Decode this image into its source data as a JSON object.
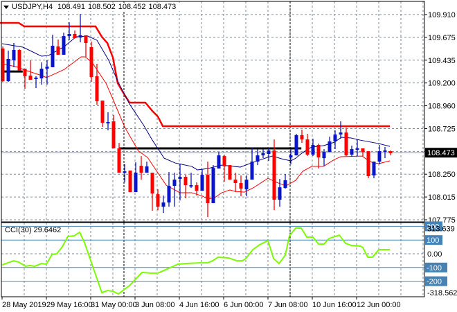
{
  "header": {
    "symbol": "USDJPY,H4",
    "open": "108.491",
    "high": "108.502",
    "low": "108.452",
    "close": "108.473"
  },
  "cci": {
    "title": "CCI(30)",
    "value": "29.6462",
    "max_label": "313.639",
    "min_label": "-318.5623",
    "zero_label": "0.00",
    "levels": [
      {
        "value": 200,
        "label": "200"
      },
      {
        "value": 100,
        "label": "100"
      },
      {
        "value": -100,
        "label": "-100"
      },
      {
        "value": -200,
        "label": "-200"
      }
    ]
  },
  "price_axis": [
    "109.910",
    "109.675",
    "109.435",
    "109.200",
    "108.960",
    "108.725",
    "108.490",
    "108.250",
    "108.015",
    "107.775"
  ],
  "current_price_label": "108.473",
  "time_axis": [
    "28 May 2019",
    "29 May 16:00",
    "31 May 00:00",
    "3 Jun 08:00",
    "4 Jun 16:00",
    "6 Jun 00:00",
    "7 Jun 08:00",
    "10 Jun 16:00",
    "12 Jun 00:00"
  ],
  "colors": {
    "bull": "#0a14c8",
    "bear": "#ff0000",
    "ma": "#000080",
    "envelope": "#ff0000",
    "channel": "#ff0000",
    "level": "#000000",
    "cci": "#7cfc00",
    "cci_levels": "#4682b4",
    "grid": "#7f8a99"
  },
  "chart_data": {
    "type": "candlestick",
    "title": "USDJPY,H4",
    "ylim": [
      107.775,
      109.91
    ],
    "current_price": 108.473,
    "candles_ohlc": [
      [
        109.556,
        109.578,
        109.21,
        109.217
      ],
      [
        109.217,
        109.535,
        109.21,
        109.448
      ],
      [
        109.434,
        109.614,
        109.362,
        109.542
      ],
      [
        109.542,
        109.55,
        109.326,
        109.326
      ],
      [
        109.347,
        109.347,
        109.138,
        109.268
      ],
      [
        109.275,
        109.434,
        109.232,
        109.232
      ],
      [
        109.239,
        109.268,
        109.145,
        109.254
      ],
      [
        109.246,
        109.412,
        109.181,
        109.347
      ],
      [
        109.347,
        109.434,
        109.181,
        109.369
      ],
      [
        109.362,
        109.701,
        109.362,
        109.585
      ],
      [
        109.578,
        109.65,
        109.492,
        109.492
      ],
      [
        109.492,
        109.722,
        109.492,
        109.686
      ],
      [
        109.686,
        109.83,
        109.643,
        109.708
      ],
      [
        109.708,
        109.744,
        109.665,
        109.665
      ],
      [
        109.672,
        109.917,
        109.621,
        109.694
      ],
      [
        109.694,
        109.694,
        109.47,
        109.614
      ],
      [
        109.571,
        109.629,
        109.21,
        109.261
      ],
      [
        109.268,
        109.398,
        108.972,
        109.008
      ],
      [
        109.015,
        109.015,
        108.741,
        108.784
      ],
      [
        108.784,
        108.893,
        108.705,
        108.792
      ],
      [
        108.799,
        108.864,
        108.518,
        108.518
      ],
      [
        108.518,
        108.575,
        108.265,
        108.265
      ],
      [
        108.265,
        108.352,
        108.164,
        108.279
      ],
      [
        108.287,
        108.287,
        108.063,
        108.063
      ],
      [
        108.063,
        108.373,
        108.063,
        108.265
      ],
      [
        108.337,
        108.438,
        108.193,
        108.265
      ],
      [
        108.265,
        108.38,
        108.265,
        108.33
      ],
      [
        108.265,
        108.265,
        107.868,
        108.049
      ],
      [
        108.041,
        108.092,
        107.875,
        107.911
      ],
      [
        107.911,
        108.027,
        107.846,
        107.955
      ],
      [
        107.955,
        108.272,
        107.911,
        108.128
      ],
      [
        108.128,
        108.265,
        107.911,
        108.193
      ],
      [
        108.2,
        108.352,
        107.976,
        108.222
      ],
      [
        108.222,
        108.243,
        107.998,
        108.135
      ],
      [
        108.128,
        108.265,
        108.106,
        108.135
      ],
      [
        108.135,
        108.164,
        108.027,
        108.077
      ],
      [
        108.077,
        108.301,
        108.077,
        108.243
      ],
      [
        108.243,
        108.38,
        107.803,
        107.948
      ],
      [
        107.948,
        108.344,
        107.948,
        108.315
      ],
      [
        108.308,
        108.481,
        108.308,
        108.445
      ],
      [
        108.438,
        108.453,
        108.171,
        108.33
      ],
      [
        108.344,
        108.344,
        108.193,
        108.193
      ],
      [
        108.193,
        108.265,
        108.063,
        108.157
      ],
      [
        108.157,
        108.236,
        108.02,
        108.099
      ],
      [
        108.092,
        108.236,
        108.02,
        108.193
      ],
      [
        108.193,
        108.525,
        108.193,
        108.38
      ],
      [
        108.38,
        108.51,
        108.344,
        108.445
      ],
      [
        108.445,
        108.51,
        108.416,
        108.467
      ],
      [
        108.46,
        108.525,
        108.388,
        108.496
      ],
      [
        108.496,
        108.611,
        107.875,
        107.984
      ],
      [
        107.984,
        108.2,
        107.911,
        108.113
      ],
      [
        108.106,
        108.251,
        108.099,
        108.186
      ],
      [
        108.424,
        108.51,
        108.352,
        108.445
      ],
      [
        108.445,
        108.669,
        108.445,
        108.655
      ],
      [
        108.655,
        108.712,
        108.575,
        108.611
      ],
      [
        108.611,
        108.669,
        108.438,
        108.453
      ],
      [
        108.453,
        108.619,
        108.438,
        108.554
      ],
      [
        108.554,
        108.568,
        108.308,
        108.424
      ],
      [
        108.416,
        108.51,
        108.337,
        108.481
      ],
      [
        108.481,
        108.64,
        108.481,
        108.59
      ],
      [
        108.59,
        108.705,
        108.51,
        108.662
      ],
      [
        108.662,
        108.799,
        108.619,
        108.683
      ],
      [
        108.683,
        108.734,
        108.438,
        108.445
      ],
      [
        108.453,
        108.546,
        108.431,
        108.51
      ],
      [
        108.503,
        108.611,
        108.438,
        108.518
      ],
      [
        108.518,
        108.518,
        108.438,
        108.481
      ],
      [
        108.489,
        108.489,
        108.207,
        108.229
      ],
      [
        108.236,
        108.38,
        108.207,
        108.38
      ],
      [
        108.38,
        108.554,
        108.352,
        108.489
      ],
      [
        108.489,
        108.532,
        108.416,
        108.496
      ],
      [
        108.489,
        108.496,
        108.445,
        108.467
      ]
    ],
    "lines": {
      "ma": [
        [
          -0.13,
          109.607
        ],
        [
          3.63,
          109.571
        ],
        [
          7,
          109.477
        ],
        [
          8.25,
          109.484
        ],
        [
          11.13,
          109.578
        ],
        [
          13.25,
          109.679
        ],
        [
          15.38,
          109.686
        ],
        [
          17,
          109.643
        ],
        [
          19.13,
          109.434
        ],
        [
          20.75,
          109.217
        ],
        [
          22.88,
          108.979
        ],
        [
          25.38,
          108.763
        ],
        [
          27,
          108.604
        ],
        [
          29.13,
          108.416
        ],
        [
          31.13,
          108.366
        ],
        [
          34.13,
          108.33
        ],
        [
          35.13,
          108.294
        ],
        [
          37,
          108.308
        ],
        [
          39.5,
          108.344
        ],
        [
          42.88,
          108.323
        ],
        [
          44.88,
          108.366
        ],
        [
          47.38,
          108.416
        ],
        [
          48.63,
          108.438
        ],
        [
          50.38,
          108.409
        ],
        [
          52,
          108.388
        ],
        [
          52.88,
          108.416
        ],
        [
          54.13,
          108.474
        ],
        [
          55.75,
          108.532
        ],
        [
          57.88,
          108.546
        ],
        [
          59.88,
          108.582
        ],
        [
          61.13,
          108.633
        ],
        [
          62.88,
          108.626
        ],
        [
          64.5,
          108.604
        ],
        [
          67.88,
          108.568
        ],
        [
          69.88,
          108.539
        ]
      ],
      "envelope_low": [
        [
          -0.13,
          109.398
        ],
        [
          2.88,
          109.362
        ],
        [
          3.63,
          109.34
        ],
        [
          7.38,
          109.268
        ],
        [
          7.88,
          109.254
        ],
        [
          11.13,
          109.34
        ],
        [
          14.13,
          109.47
        ],
        [
          14.88,
          109.47
        ],
        [
          16.13,
          109.412
        ],
        [
          18.63,
          109.196
        ],
        [
          19.88,
          109.03
        ],
        [
          22,
          108.741
        ],
        [
          24.5,
          108.489
        ],
        [
          26.13,
          108.424
        ],
        [
          29.5,
          108.135
        ],
        [
          32,
          108.056
        ],
        [
          34.13,
          108.056
        ],
        [
          36.13,
          108.02
        ],
        [
          37,
          107.991
        ],
        [
          38.25,
          108.005
        ],
        [
          39.5,
          108.056
        ],
        [
          41,
          108.085
        ],
        [
          42,
          108.07
        ],
        [
          43.63,
          108.063
        ],
        [
          45.38,
          108.113
        ],
        [
          47.88,
          108.207
        ],
        [
          49.13,
          108.171
        ],
        [
          51.13,
          108.128
        ],
        [
          52.88,
          108.186
        ],
        [
          54.13,
          108.279
        ],
        [
          55.75,
          108.33
        ],
        [
          57.88,
          108.33
        ],
        [
          59.88,
          108.402
        ],
        [
          61,
          108.431
        ],
        [
          64.88,
          108.438
        ],
        [
          65.75,
          108.402
        ],
        [
          66.63,
          108.373
        ],
        [
          67.88,
          108.359
        ],
        [
          69.88,
          108.388
        ]
      ],
      "channel_high": [
        [
          -0.5,
          109.823
        ],
        [
          2.88,
          109.823
        ],
        [
          3.88,
          109.787
        ],
        [
          16.75,
          109.787
        ],
        [
          17.88,
          109.679
        ],
        [
          18.88,
          109.614
        ],
        [
          19.88,
          109.463
        ],
        [
          20.75,
          109.196
        ],
        [
          22,
          109.073
        ],
        [
          22.88,
          108.994
        ],
        [
          25.75,
          108.994
        ],
        [
          27,
          108.907
        ],
        [
          28,
          108.849
        ],
        [
          28.88,
          108.749
        ],
        [
          69.88,
          108.749
        ]
      ],
      "level_old": [
        [
          0.25,
          109.318
        ],
        [
          3.6,
          109.318
        ]
      ],
      "level": [
        [
          21,
          108.518
        ],
        [
          53.9,
          108.518
        ]
      ]
    },
    "cci_series": [
      [
        -0.13,
        -81
      ],
      [
        2,
        -51
      ],
      [
        2.88,
        -61
      ],
      [
        4.13,
        -91
      ],
      [
        4.88,
        -86
      ],
      [
        5.75,
        -91
      ],
      [
        7,
        -71
      ],
      [
        7.88,
        -76
      ],
      [
        8.88,
        -5
      ],
      [
        9.75,
        0
      ],
      [
        10.75,
        51
      ],
      [
        11.75,
        126
      ],
      [
        12.88,
        131
      ],
      [
        13.88,
        157
      ],
      [
        14.75,
        81
      ],
      [
        17.88,
        -283
      ],
      [
        18.88,
        -268
      ],
      [
        19.88,
        -273
      ],
      [
        20.88,
        -293
      ],
      [
        22,
        -258
      ],
      [
        22.88,
        -232
      ],
      [
        25.13,
        -136
      ],
      [
        26.63,
        -141
      ],
      [
        28,
        -141
      ],
      [
        29.13,
        -121
      ],
      [
        31.63,
        -76
      ],
      [
        33.25,
        -71
      ],
      [
        35.38,
        -66
      ],
      [
        37,
        -66
      ],
      [
        37.88,
        -51
      ],
      [
        38.88,
        -25
      ],
      [
        40.75,
        -30
      ],
      [
        42.25,
        -51
      ],
      [
        43.25,
        -51
      ],
      [
        43.88,
        -35
      ],
      [
        45.13,
        30
      ],
      [
        46.38,
        66
      ],
      [
        47.38,
        86
      ],
      [
        47.88,
        96
      ],
      [
        48.88,
        -35
      ],
      [
        49.88,
        -71
      ],
      [
        51,
        -10
      ],
      [
        51.75,
        131
      ],
      [
        52.88,
        187
      ],
      [
        53.88,
        187
      ],
      [
        54.88,
        121
      ],
      [
        56,
        121
      ],
      [
        57,
        71
      ],
      [
        58,
        71
      ],
      [
        58.88,
        111
      ],
      [
        60.75,
        136
      ],
      [
        61.88,
        76
      ],
      [
        62.88,
        61
      ],
      [
        64.5,
        56
      ],
      [
        65,
        46
      ],
      [
        65.88,
        -25
      ],
      [
        66.75,
        -25
      ],
      [
        67.88,
        30
      ],
      [
        69.88,
        30
      ]
    ],
    "cci_range": [
      -318.5623,
      313.639
    ]
  }
}
